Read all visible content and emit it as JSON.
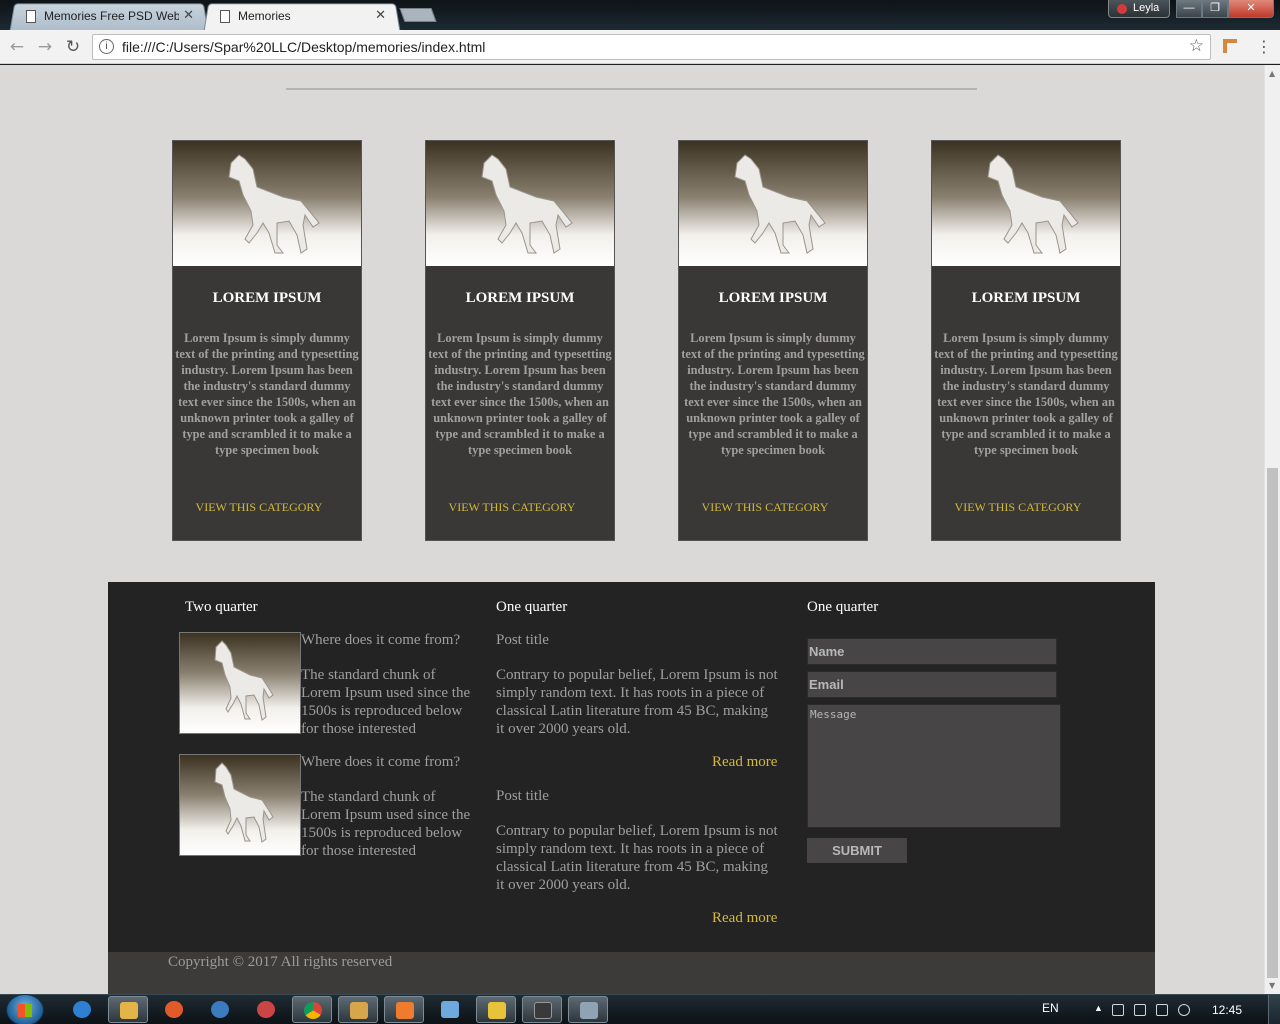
{
  "browser": {
    "tabs": [
      {
        "title": "Memories Free PSD Web",
        "close": "✕"
      },
      {
        "title": "Memories",
        "close": "✕"
      }
    ],
    "user": "Leyla",
    "url": "file:///C:/Users/Spar%20LLC/Desktop/memories/index.html",
    "window_controls": {
      "minimize": "—",
      "maximize": "❐",
      "close": "✕"
    }
  },
  "cards": [
    {
      "title": "LOREM IPSUM",
      "text": "Lorem Ipsum is simply dummy text of the printing and typesetting industry. Lorem Ipsum has been the industry's standard dummy text ever since the 1500s, when an unknown printer took a galley of type and scrambled it to make a type specimen book",
      "link": "VIEW THIS CATEGORY"
    },
    {
      "title": "LOREM IPSUM",
      "text": "Lorem Ipsum is simply dummy text of the printing and typesetting industry. Lorem Ipsum has been the industry's standard dummy text ever since the 1500s, when an unknown printer took a galley of type and scrambled it to make a type specimen book",
      "link": "VIEW THIS CATEGORY"
    },
    {
      "title": "LOREM IPSUM",
      "text": "Lorem Ipsum is simply dummy text of the printing and typesetting industry. Lorem Ipsum has been the industry's standard dummy text ever since the 1500s, when an unknown printer took a galley of type and scrambled it to make a type specimen book",
      "link": "VIEW THIS CATEGORY"
    },
    {
      "title": "LOREM IPSUM",
      "text": "Lorem Ipsum is simply dummy text of the printing and typesetting industry. Lorem Ipsum has been the industry's standard dummy text ever since the 1500s, when an unknown printer took a galley of type and scrambled it to make a type specimen book",
      "link": "VIEW THIS CATEGORY"
    }
  ],
  "footer": {
    "col1": {
      "title": "Two quarter",
      "posts": [
        {
          "heading": "Where does it come from?",
          "text": " The standard chunk of Lorem Ipsum used since the 1500s is reproduced below for those interested"
        },
        {
          "heading": "Where does it come from?",
          "text": " The standard chunk of Lorem Ipsum used since the 1500s is reproduced below for those interested"
        }
      ]
    },
    "col2": {
      "title": "One quarter",
      "posts": [
        {
          "title": "Post title",
          "text": "Contrary to popular belief, Lorem Ipsum is not simply random text. It has roots in a piece of classical Latin literature from 45 BC, making it over 2000 years old.",
          "read_more": "Read more"
        },
        {
          "title": "Post title",
          "text": "Contrary to popular belief, Lorem Ipsum is not simply random text. It has roots in a piece of classical Latin literature from 45 BC, making it over 2000 years old.",
          "read_more": "Read more"
        }
      ]
    },
    "col3": {
      "title": "One quarter",
      "form": {
        "name_placeholder": "Name",
        "email_placeholder": "Email",
        "message_placeholder": "Message",
        "submit_label": "SUBMIT"
      }
    },
    "copyright": "Copyright © 2017 All rights reserved"
  },
  "taskbar": {
    "language": "EN",
    "time": "12:45"
  },
  "colors": {
    "page_bg": "#dad9d8",
    "card_bg": "#3a3836",
    "footer_bg": "#232323",
    "accent_gold": "#d1b93b"
  }
}
